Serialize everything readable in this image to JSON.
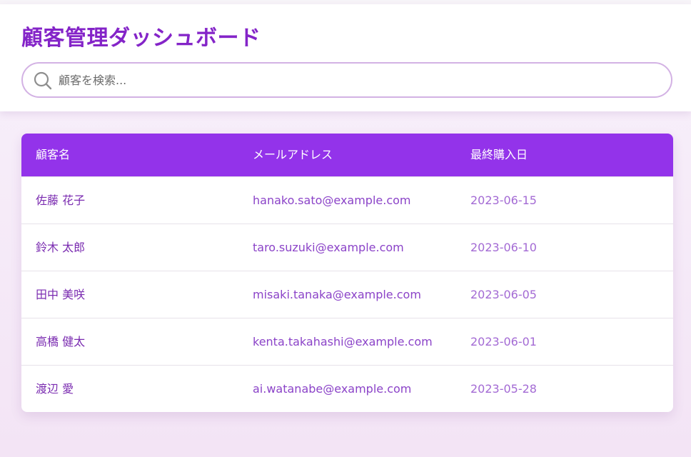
{
  "page": {
    "title": "顧客管理ダッシュボード"
  },
  "search": {
    "placeholder": "顧客を検索...",
    "value": "",
    "icon": "search-icon"
  },
  "table": {
    "columns": [
      "顧客名",
      "メールアドレス",
      "最終購入日"
    ],
    "rows": [
      {
        "name": "佐藤 花子",
        "email": "hanako.sato@example.com",
        "last_purchase": "2023-06-15"
      },
      {
        "name": "鈴木 太郎",
        "email": "taro.suzuki@example.com",
        "last_purchase": "2023-06-10"
      },
      {
        "name": "田中 美咲",
        "email": "misaki.tanaka@example.com",
        "last_purchase": "2023-06-05"
      },
      {
        "name": "高橋 健太",
        "email": "kenta.takahashi@example.com",
        "last_purchase": "2023-06-01"
      },
      {
        "name": "渡辺 愛",
        "email": "ai.watanabe@example.com",
        "last_purchase": "2023-05-28"
      }
    ]
  },
  "colors": {
    "accent": "#9333ea",
    "title": "#8424c8",
    "search_border": "#d3b2e4",
    "background": "#f6ebf7"
  }
}
